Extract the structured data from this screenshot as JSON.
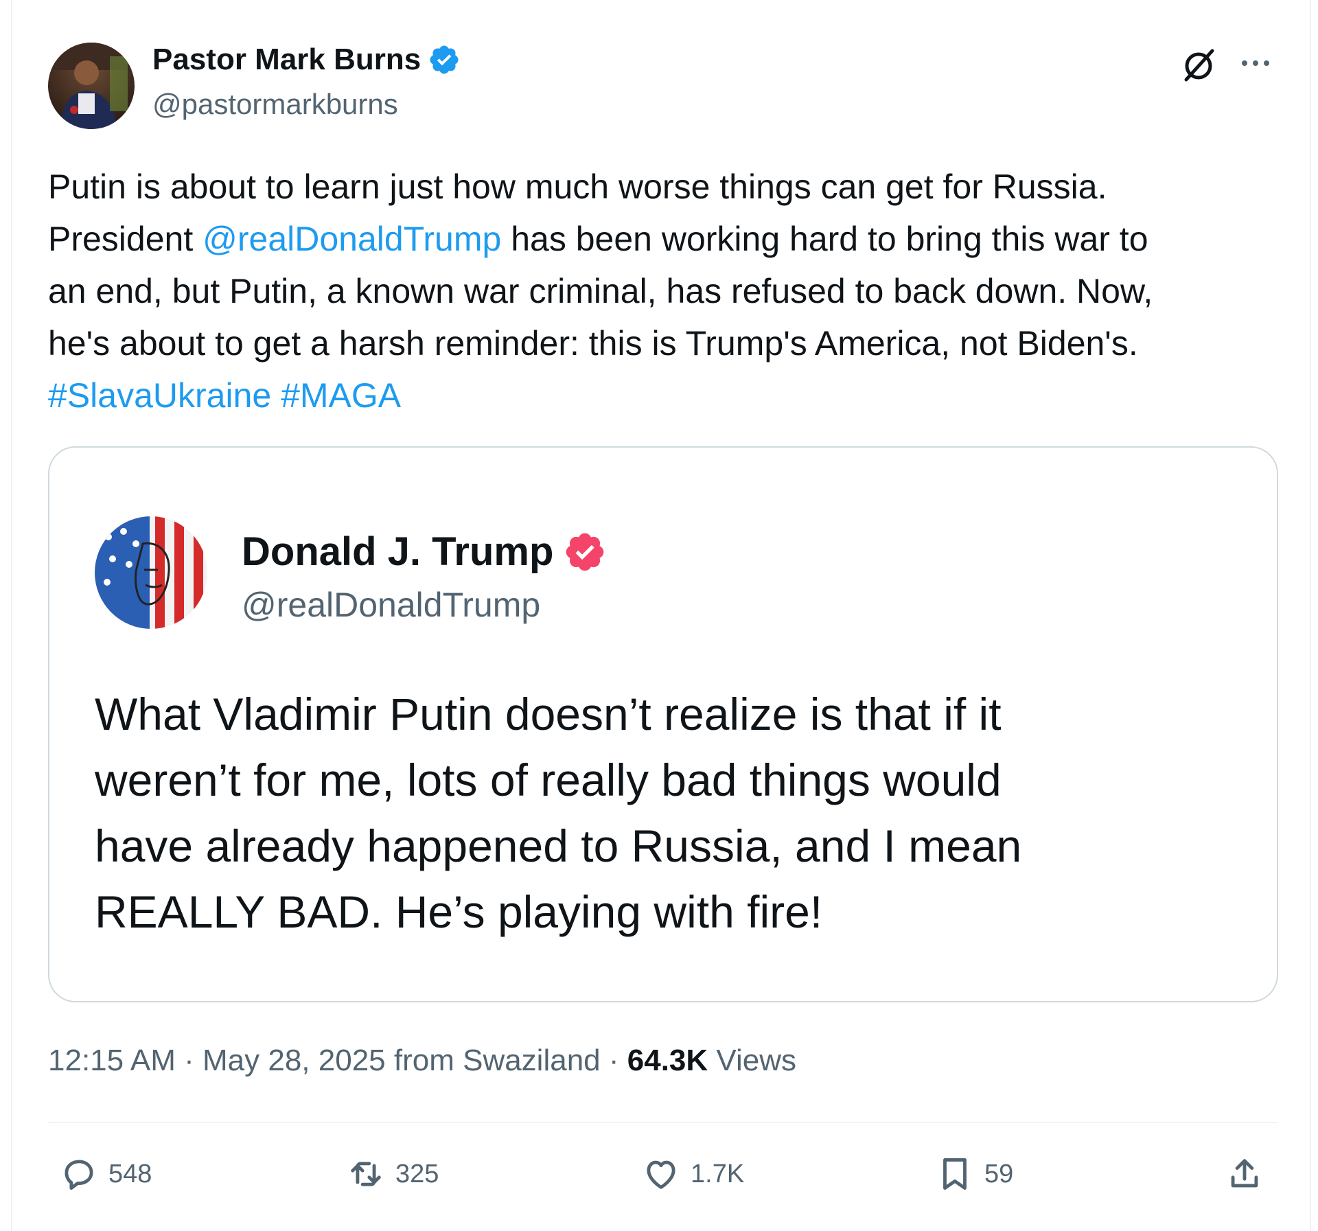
{
  "author": {
    "name": "Pastor Mark Burns",
    "handle": "@pastormarkburns"
  },
  "tweet": {
    "lines": [
      [
        {
          "text": "Putin is about to learn just how much worse things can get for Russia.",
          "link": false
        }
      ],
      [
        {
          "text": "President ",
          "link": false
        },
        {
          "text": "@realDonaldTrump",
          "link": true
        },
        {
          "text": " has been working hard to bring this war to",
          "link": false
        }
      ],
      [
        {
          "text": "an end, but Putin, a known war criminal, has refused to back down. Now,",
          "link": false
        }
      ],
      [
        {
          "text": "he's about to get a harsh reminder: this is Trump's America, not Biden's.",
          "link": false
        }
      ],
      [
        {
          "text": "#SlavaUkraine",
          "link": true
        },
        {
          "text": " ",
          "link": false
        },
        {
          "text": "#MAGA",
          "link": true
        }
      ]
    ]
  },
  "quote": {
    "name": "Donald J. Trump",
    "handle": "@realDonaldTrump",
    "lines": [
      "What Vladimir Putin doesn’t realize is that if it",
      "weren’t for me, lots of really bad things would",
      "have already happened to Russia, and I mean",
      "REALLY BAD. He’s playing with fire!"
    ]
  },
  "meta": {
    "time": "12:15 AM",
    "sep1": " · ",
    "date": "May 28, 2025",
    "source": " from Swaziland",
    "sep2": " · ",
    "views_count": "64.3K",
    "views_label": " Views"
  },
  "actions": {
    "replies": "548",
    "reposts": "325",
    "likes": "1.7K",
    "bookmarks": "59"
  },
  "colors": {
    "link": "#1d9bf0",
    "verified_blue": "#1d9bf0",
    "verified_pink": "#f4446a",
    "secondary_text": "#536471"
  },
  "icons": [
    "verified-badge-icon",
    "grok-icon",
    "more-icon",
    "reply-icon",
    "repost-icon",
    "like-icon",
    "bookmark-icon",
    "share-icon"
  ]
}
